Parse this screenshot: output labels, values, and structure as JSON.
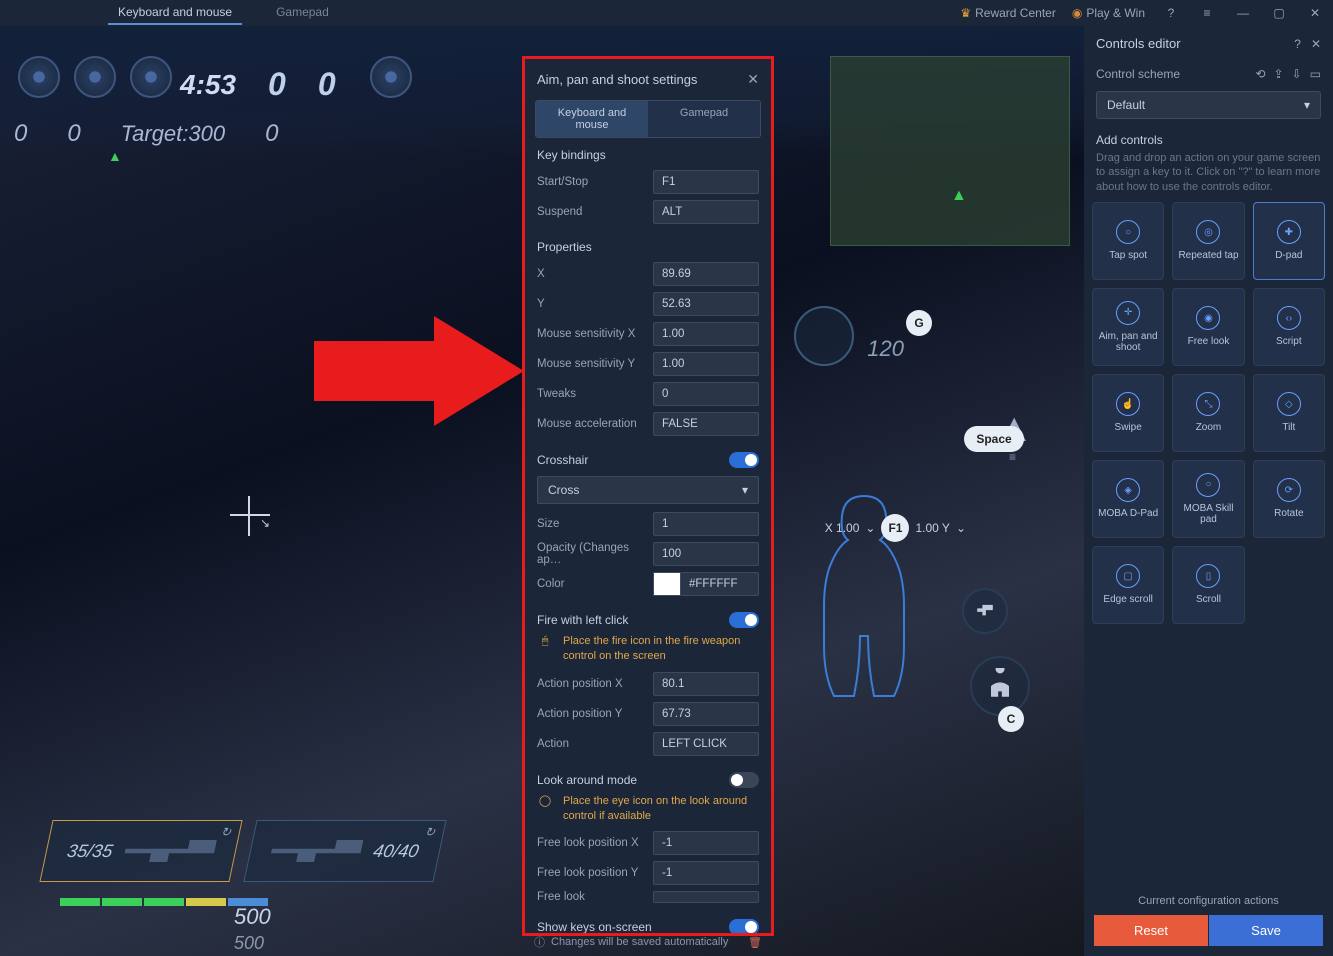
{
  "titlebar": {
    "tab_keyboard": "Keyboard and mouse",
    "tab_gamepad": "Gamepad",
    "reward": "Reward Center",
    "playwin": "Play & Win"
  },
  "hud": {
    "timer": "4:53",
    "score_left": "0",
    "score_right": "0",
    "zero2": "0",
    "zero3": "0",
    "target_label": "Target:300",
    "zero4": "0",
    "ammo1": "35/35",
    "ammo2": "40/40",
    "hp1": "500",
    "hp2": "500",
    "num120": "120",
    "badge_G": "G",
    "badge_C": "C",
    "space": "Space",
    "aim_x": "X 1.00",
    "aim_f1": "F1",
    "aim_y": "1.00 Y"
  },
  "modal": {
    "title": "Aim, pan and shoot settings",
    "tab_km": "Keyboard and mouse",
    "tab_gp": "Gamepad",
    "sec_keybindings": "Key bindings",
    "start_stop_lbl": "Start/Stop",
    "start_stop_val": "F1",
    "suspend_lbl": "Suspend",
    "suspend_val": "ALT",
    "sec_props": "Properties",
    "x_lbl": "X",
    "x_val": "89.69",
    "y_lbl": "Y",
    "y_val": "52.63",
    "msx_lbl": "Mouse sensitivity X",
    "msx_val": "1.00",
    "msy_lbl": "Mouse sensitivity Y",
    "msy_val": "1.00",
    "tweaks_lbl": "Tweaks",
    "tweaks_val": "0",
    "maccel_lbl": "Mouse acceleration",
    "maccel_val": "FALSE",
    "sec_crosshair": "Crosshair",
    "cross_type": "Cross",
    "size_lbl": "Size",
    "size_val": "1",
    "opacity_lbl": "Opacity (Changes ap…",
    "opacity_val": "100",
    "color_lbl": "Color",
    "color_val": "#FFFFFF",
    "sec_fire": "Fire with left click",
    "fire_tip": "Place the fire icon in the fire weapon control on the screen",
    "apx_lbl": "Action position X",
    "apx_val": "80.1",
    "apy_lbl": "Action position Y",
    "apy_val": "67.73",
    "action_lbl": "Action",
    "action_val": "LEFT CLICK",
    "sec_look": "Look around mode",
    "look_tip": "Place the eye icon on the look around control if available",
    "flx_lbl": "Free look position X",
    "flx_val": "-1",
    "fly_lbl": "Free look position Y",
    "fly_val": "-1",
    "fl_lbl": "Free look",
    "fl_val": "",
    "sec_showkeys": "Show keys on-screen",
    "footer_note": "Changes will be saved automatically"
  },
  "sidebar": {
    "title": "Controls editor",
    "scheme_label": "Control scheme",
    "scheme_value": "Default",
    "addcontrols": "Add controls",
    "addhelp": "Drag and drop an action on your game screen to assign a key to it. Click on \"?\" to learn more about how to use the controls editor.",
    "tiles": {
      "tap": "Tap spot",
      "rep": "Repeated tap",
      "dpad": "D-pad",
      "aim": "Aim, pan and shoot",
      "free": "Free look",
      "script": "Script",
      "swipe": "Swipe",
      "zoom": "Zoom",
      "tilt": "Tilt",
      "mobad": "MOBA D-Pad",
      "mobas": "MOBA Skill pad",
      "rotate": "Rotate",
      "edge": "Edge scroll",
      "scroll": "Scroll"
    },
    "cfg_label": "Current configuration actions",
    "reset_btn": "Reset",
    "save_btn": "Save"
  }
}
